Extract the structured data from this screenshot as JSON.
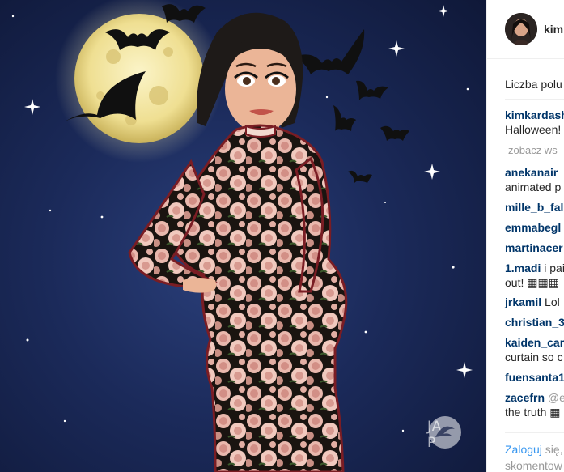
{
  "post": {
    "username": "kim",
    "likes_label": "Liczba polu",
    "caption": {
      "user": "kimkardash",
      "text": "Halloween!"
    },
    "view_more": "zobacz ws",
    "watermark_letters": "JA\nP"
  },
  "comments": [
    {
      "user": "anekanair",
      "text": "",
      "text2": "animated p"
    },
    {
      "user": "mille_b_fal",
      "text": "",
      "text2": ""
    },
    {
      "user": "emmabegl",
      "text": "",
      "text2": ""
    },
    {
      "user": "martinacer",
      "text": "",
      "text2": ""
    },
    {
      "user": "1.madi",
      "text": "i pai",
      "text2": "out! ▦▦▦"
    },
    {
      "user": "jrkamil",
      "text": "Lol",
      "text2": ""
    },
    {
      "user": "christian_3",
      "text": "",
      "text2": ""
    },
    {
      "user": "kaiden_car",
      "text": "",
      "text2": "curtain so c"
    },
    {
      "user": "fuensanta1",
      "text": "",
      "text2": ""
    },
    {
      "user": "zacefrn",
      "text": "@e",
      "text2": "the truth ▦"
    }
  ],
  "footer": {
    "login_link": "Zaloguj",
    "login_rest": " się,",
    "login_line2": "skomentow"
  },
  "colors": {
    "sky_dark": "#0f1838",
    "sky_mid": "#2a3f7a",
    "moon": "#f3e7a6",
    "username_link": "#003569",
    "login_link": "#3897f0",
    "muted": "#999999"
  }
}
